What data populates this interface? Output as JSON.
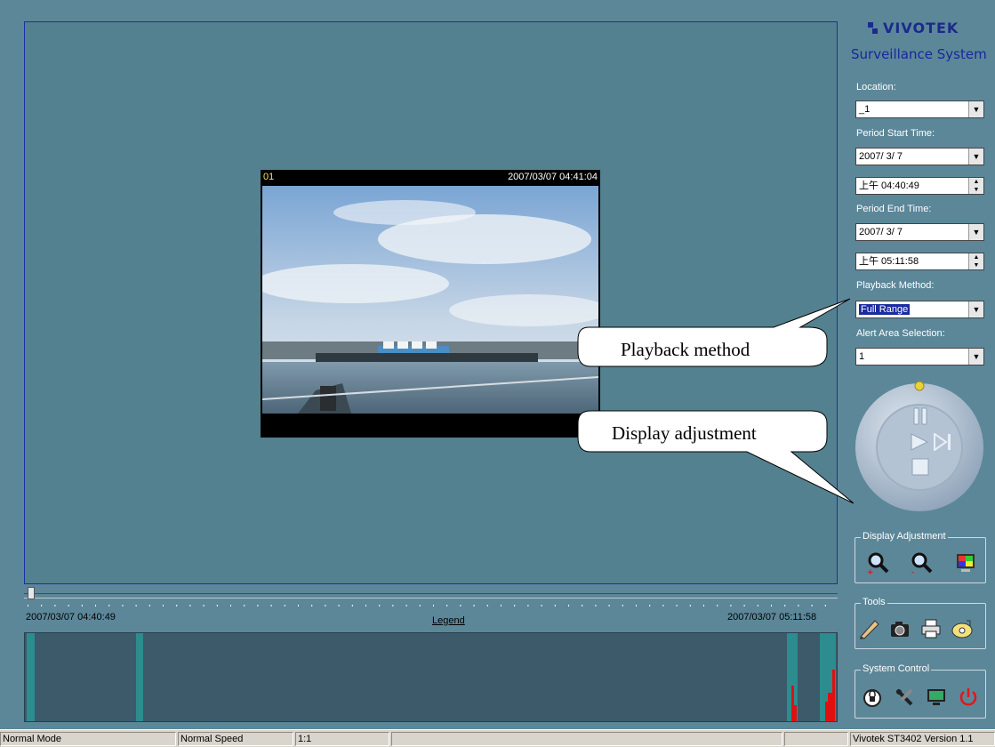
{
  "video": {
    "camera_id": "01",
    "timestamp": "2007/03/07 04:41:04"
  },
  "brand": {
    "logo": "VIVOTEK",
    "subtitle": "Surveillance System"
  },
  "panel": {
    "location_label": "Location:",
    "location_value": "_1",
    "start_label": "Period Start Time:",
    "start_date": "2007/ 3/ 7",
    "start_time": "上午 04:40:49",
    "end_label": "Period End Time:",
    "end_date": "2007/ 3/ 7",
    "end_time": "上午 05:11:58",
    "playback_label": "Playback Method:",
    "playback_value": "Full Range",
    "alert_label": "Alert Area Selection:",
    "alert_value": "1"
  },
  "groups": {
    "display": "Display Adjustment",
    "tools": "Tools",
    "system": "System Control"
  },
  "timeline": {
    "start": "2007/03/07 04:40:49",
    "end": "2007/03/07 05:11:58",
    "legend": "Legend"
  },
  "callouts": {
    "playback": "Playback method",
    "display": "Display adjustment"
  },
  "status": {
    "mode": "Normal Mode",
    "speed": "Normal Speed",
    "ratio": "1:1",
    "version": "Vivotek ST3402   Version 1.1"
  },
  "colors": {
    "background": "#5c8799",
    "alert": "#e01010",
    "segment": "#2c8c8e"
  }
}
